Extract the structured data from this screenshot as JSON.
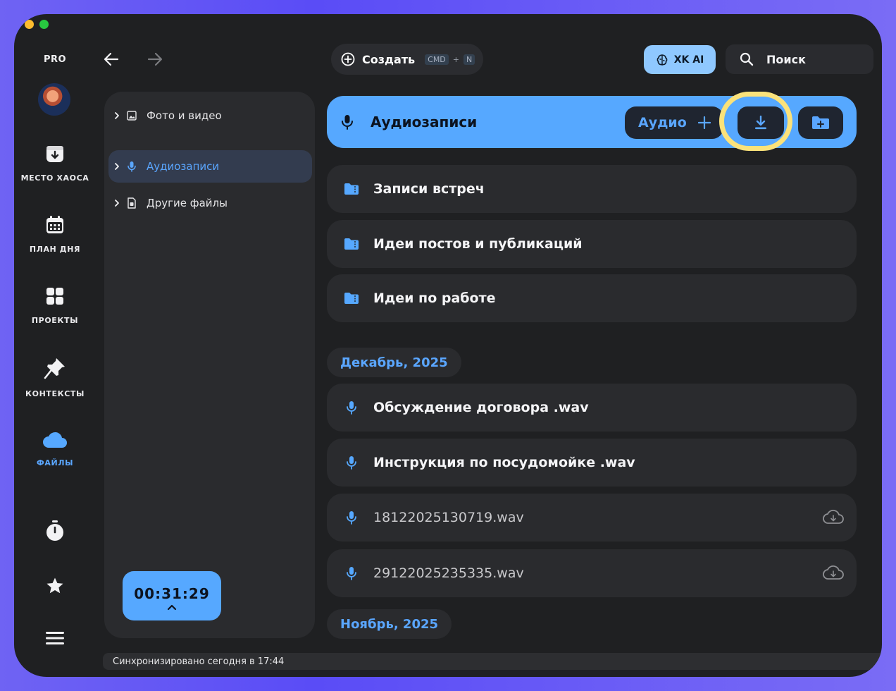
{
  "colors": {
    "accent": "#56a8ff",
    "accent_text": "#5aa6ff",
    "highlight_ring": "#fbe27a",
    "window_bg": "#1f2022",
    "panel_bg": "#2a2b2e"
  },
  "sidebar": {
    "plan": "PRO",
    "items": [
      {
        "label": "МЕСТО ХАОСА",
        "icon": "archive-download-icon"
      },
      {
        "label": "ПЛАН ДНЯ",
        "icon": "calendar-icon"
      },
      {
        "label": "ПРОЕКТЫ",
        "icon": "grid-icon"
      },
      {
        "label": "КОНТЕКСТЫ",
        "icon": "pin-icon"
      },
      {
        "label": "ФАЙЛЫ",
        "icon": "cloud-icon",
        "active": true
      }
    ],
    "bottom_icons": [
      "stopwatch-icon",
      "star-icon",
      "menu-icon"
    ]
  },
  "topbar": {
    "create_label": "Создать",
    "create_shortcut_mod": "CMD",
    "create_shortcut_plus": "+",
    "create_shortcut_key": "N",
    "ai_label": "XK AI",
    "search_label": "Поиск"
  },
  "tree": {
    "items": [
      {
        "label": "Фото и видео",
        "icon": "image-icon"
      },
      {
        "label": "Аудиозаписи",
        "icon": "mic-icon",
        "active": true
      },
      {
        "label": "Другие файлы",
        "icon": "file-icon"
      }
    ],
    "timer": "00:31:29"
  },
  "main": {
    "header_title": "Аудиозаписи",
    "audio_button_label": "Аудио",
    "folders": [
      {
        "label": "Записи встреч"
      },
      {
        "label": "Идеи постов и публикаций"
      },
      {
        "label": "Идеи по работе"
      }
    ],
    "groups": [
      {
        "label": "Декабрь, 2025",
        "files": [
          {
            "label": "Обсуждение договора .wav",
            "synced": true
          },
          {
            "label": "Инструкция по посудомойке .wav",
            "synced": true
          },
          {
            "label": "18122025130719.wav",
            "synced": false
          },
          {
            "label": "29122025235335.wav",
            "synced": false
          }
        ]
      },
      {
        "label": "Ноябрь, 2025"
      }
    ]
  },
  "status": {
    "text": "Синхронизировано сегодня в 17:44"
  }
}
